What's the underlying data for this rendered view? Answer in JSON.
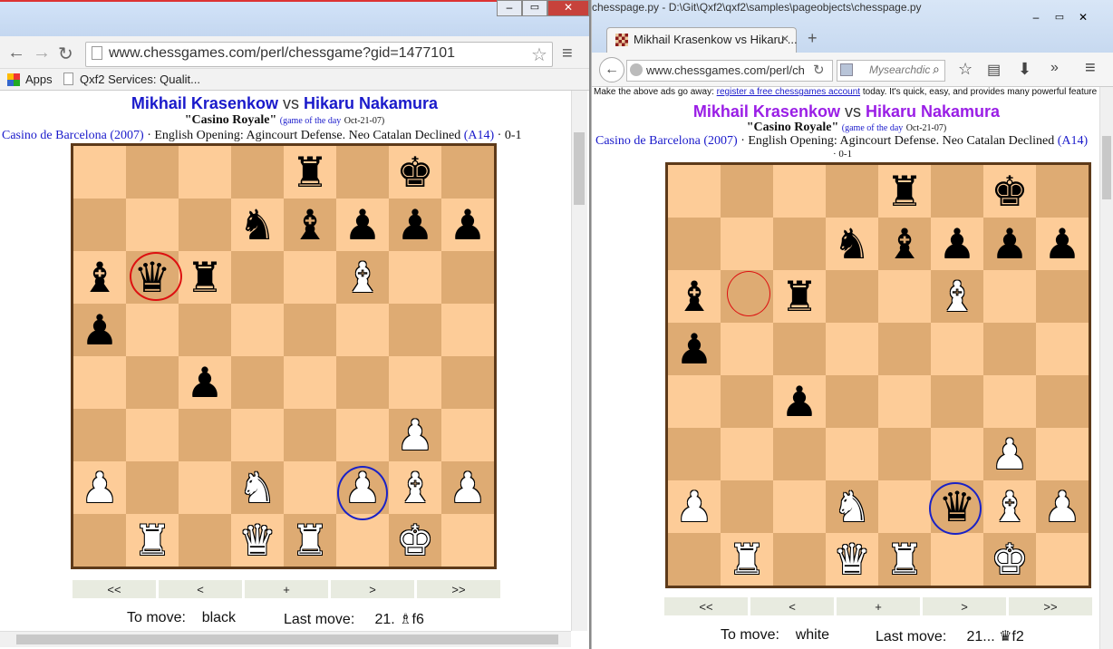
{
  "left": {
    "window_title": "chesspage.py - D:\\Git\\Qxf2\\qxf2\\samples\\pageobjects\\chesspage.py",
    "url": "www.chessgames.com/perl/chessgame?gid=1477101",
    "bookmarks": {
      "apps": "Apps",
      "qxf2": "Qxf2 Services: Qualit..."
    },
    "player_white": "Mikhail Krasenkow",
    "vs": "vs",
    "player_black": "Hikaru Nakamura",
    "game_name": "\"Casino Royale\"",
    "gotd": "(game of the day",
    "gotd_date": "Oct-21-07)",
    "event": "Casino de Barcelona (2007)",
    "sep": "·",
    "opening": "English Opening: Agincourt Defense. Neo Catalan Declined",
    "eco": "(A14)",
    "result": "0-1",
    "nav": [
      "<<",
      "<",
      "+",
      ">",
      ">>"
    ],
    "to_move_label": "To move:",
    "to_move": "black",
    "last_move_label": "Last move:",
    "last_move": "21. ♗f6"
  },
  "right": {
    "tab_title": "Mikhail Krasenkow vs Hikaru ...",
    "url": "www.chessgames.com/perl/ch",
    "search_placeholder": "Mysearchdic",
    "ads": "Make the above ads go away:",
    "ads_link": "register a free chessgames account",
    "ads_rest": "today.  It's quick, easy, and provides many powerful feature",
    "player_white": "Mikhail Krasenkow",
    "vs": "vs",
    "player_black": "Hikaru Nakamura",
    "game_name": "\"Casino Royale\"",
    "gotd": "(game of the day",
    "gotd_date": "Oct-21-07)",
    "event": "Casino de Barcelona (2007)",
    "sep": "·",
    "opening": "English Opening: Agincourt Defense. Neo Catalan Declined",
    "eco": "(A14)",
    "result": "· 0-1",
    "nav": [
      "<<",
      "<",
      "+",
      ">",
      ">>"
    ],
    "to_move_label": "To move:",
    "to_move": "white",
    "last_move_label": "Last move:",
    "last_move": "21... ♛f2"
  },
  "colors": {
    "player_left": "#1a1acb",
    "player_right": "#9a1ee6",
    "light_square": "#fdcc98",
    "dark_square": "#deab73"
  }
}
